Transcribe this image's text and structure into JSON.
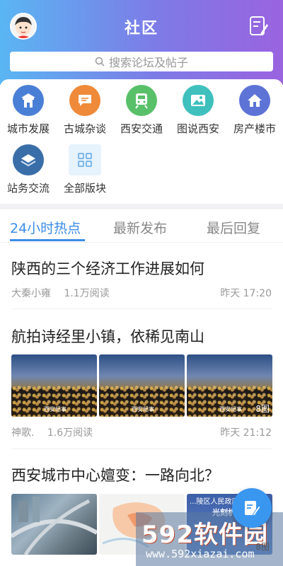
{
  "header": {
    "title": "社区"
  },
  "search": {
    "placeholder": "搜索论坛及帖子"
  },
  "categories": [
    {
      "label": "城市发展",
      "icon": "city-gate-icon",
      "color": "#4a7fd6"
    },
    {
      "label": "古城杂谈",
      "icon": "chat-bubble-icon",
      "color": "#ef8a3a"
    },
    {
      "label": "西安交通",
      "icon": "train-icon",
      "color": "#59c06a"
    },
    {
      "label": "图说西安",
      "icon": "image-icon",
      "color": "#3fc0bd"
    },
    {
      "label": "房产楼市",
      "icon": "house-icon",
      "color": "#5d73d6"
    },
    {
      "label": "站务交流",
      "icon": "layers-icon",
      "color": "#3a6ea8"
    },
    {
      "label": "全部版块",
      "icon": "grid-icon",
      "color": "#5aa6e6"
    }
  ],
  "tabs": [
    "24小时热点",
    "最新发布",
    "最后回复"
  ],
  "posts": [
    {
      "title": "陕西的三个经济工作进展如何",
      "author": "大秦小雍",
      "reads": "1.1万阅读",
      "time": "昨天 17:20"
    },
    {
      "title": "航拍诗经里小镇，依稀见南山",
      "author": "神歌.",
      "reads": "1.6万阅读",
      "time": "昨天 21:12",
      "watermark": "西安纪事",
      "image_count": "8图"
    },
    {
      "title": "西安城市中心嬗变：一路向北？"
    }
  ],
  "overlay": {
    "site": "592软件园",
    "url": "www.592xiazai.com",
    "map_text": "...陵区人民政府",
    "map_text2": "光刻机...",
    "count": "8图"
  }
}
